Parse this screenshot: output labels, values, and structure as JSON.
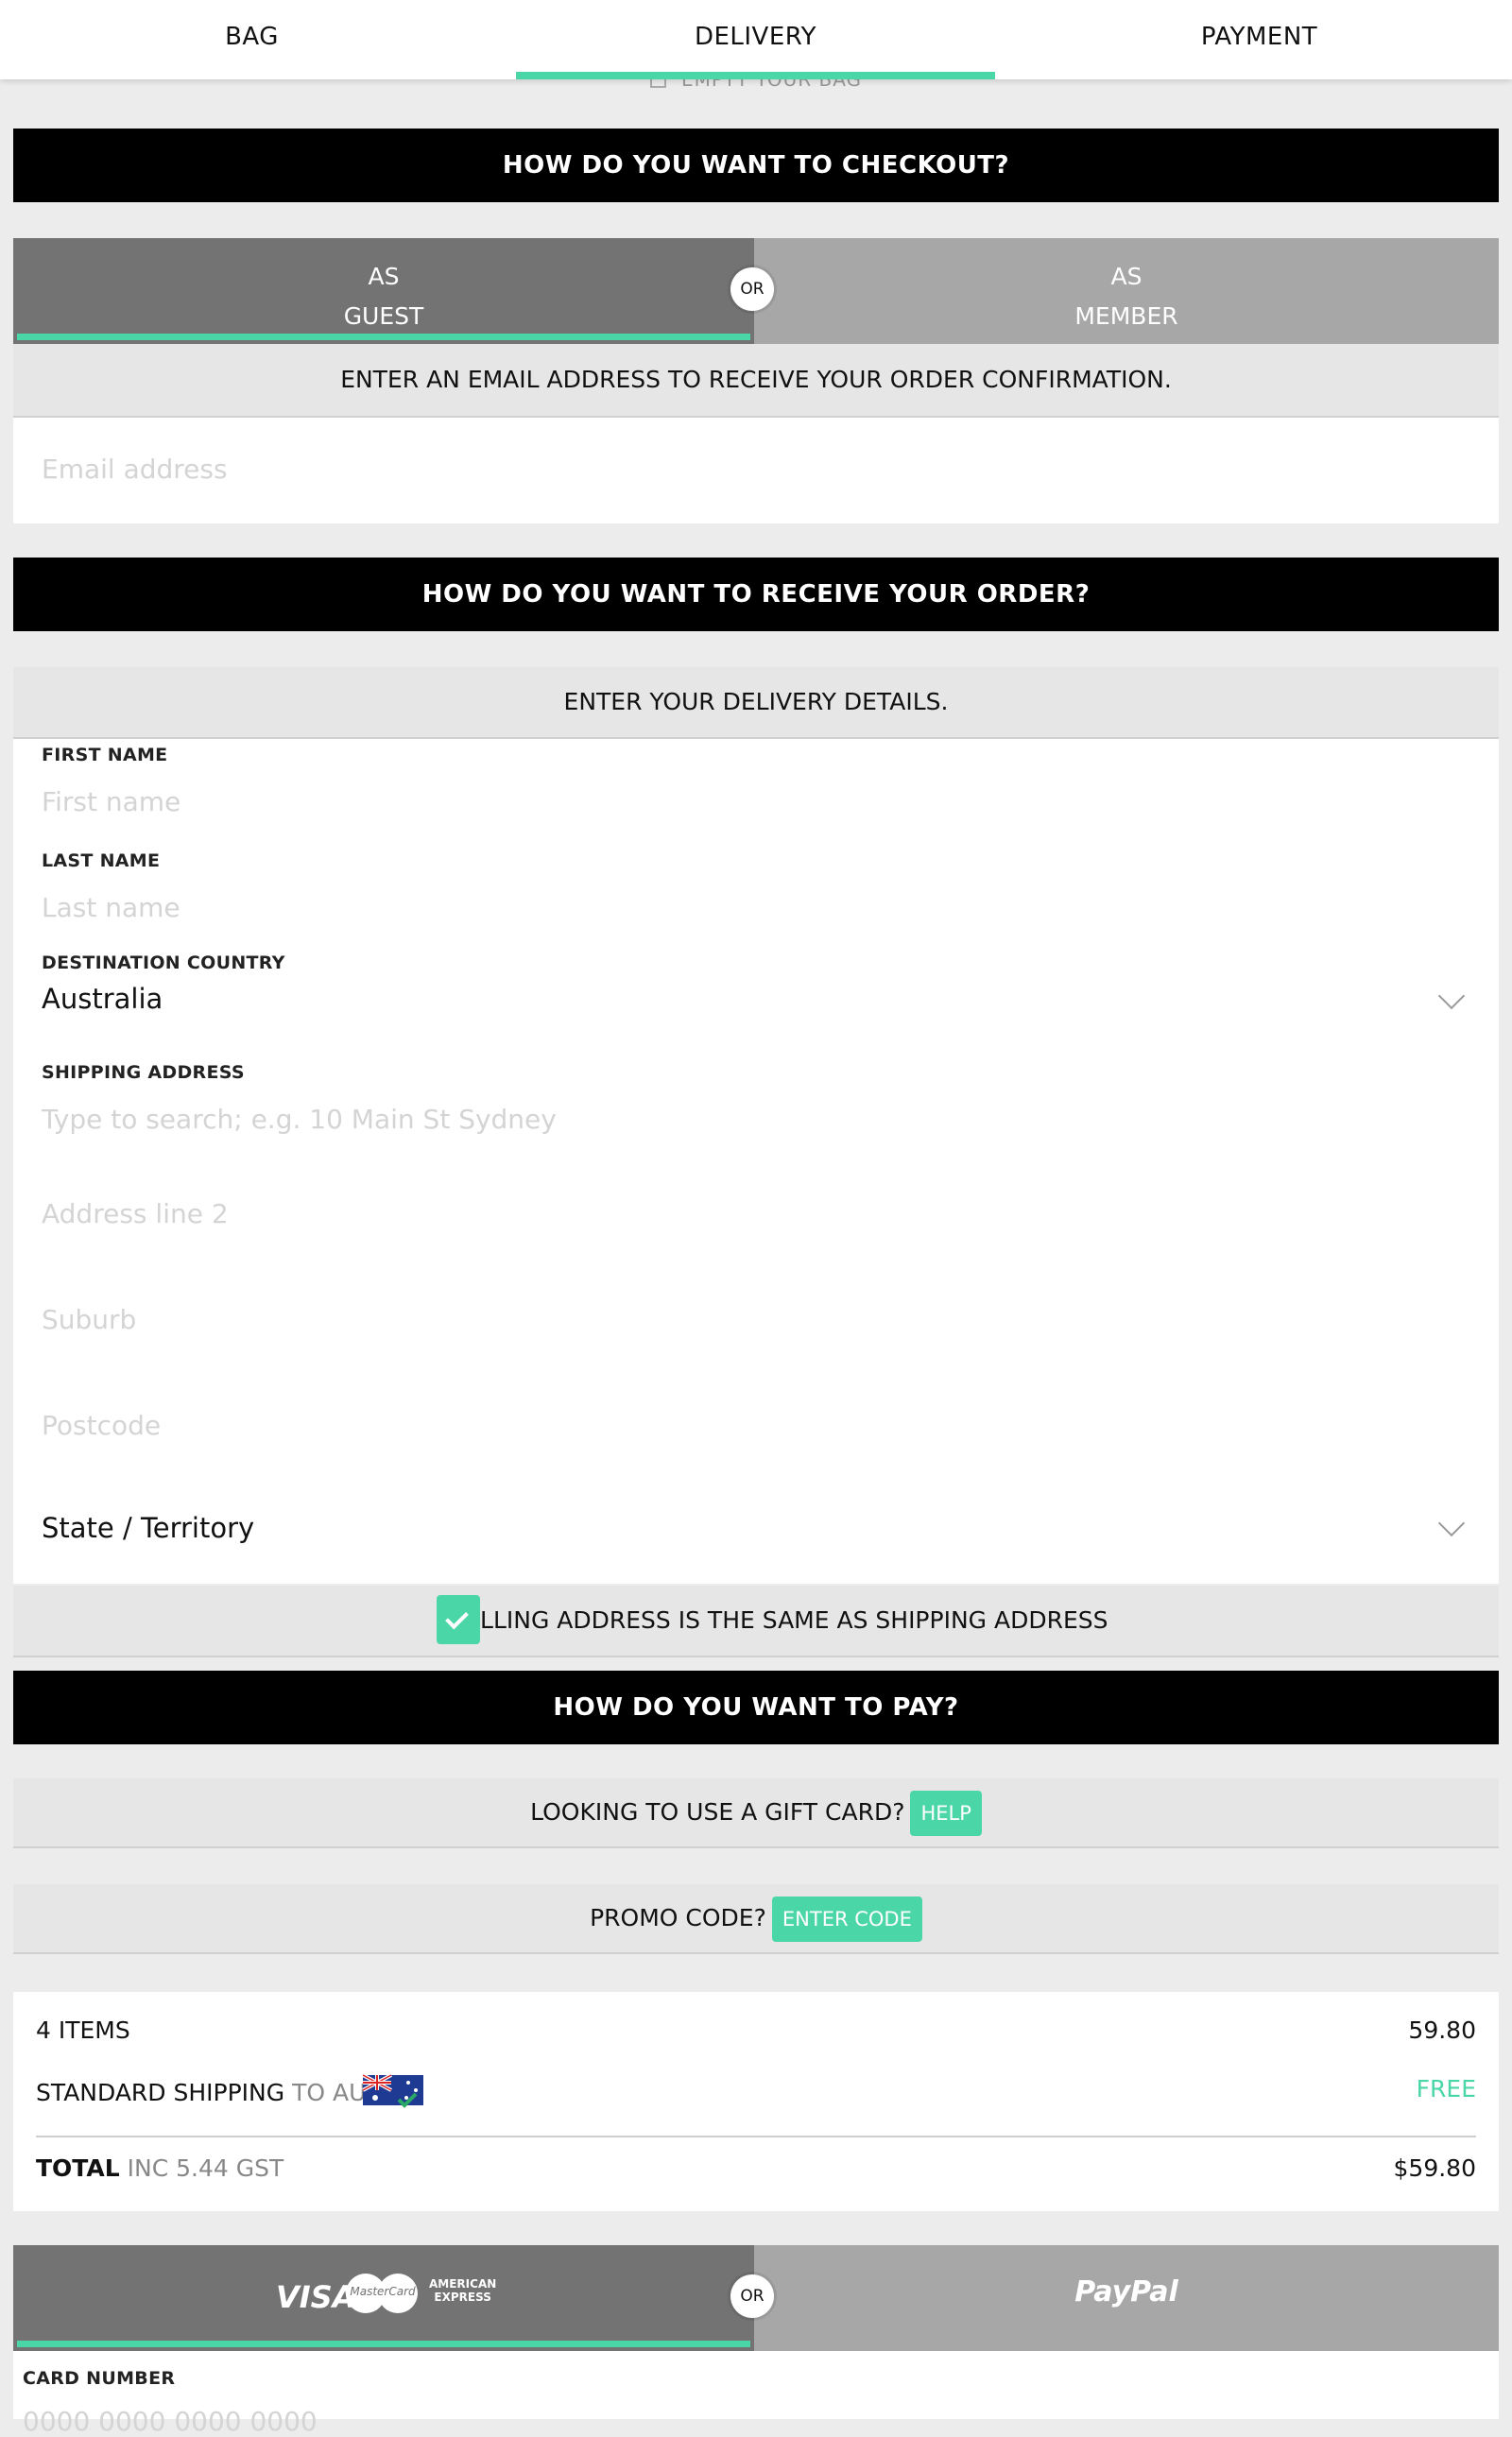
{
  "nav": {
    "tabs": [
      "BAG",
      "DELIVERY",
      "PAYMENT"
    ],
    "active": "DELIVERY"
  },
  "empty_bag_label": "EMPTY YOUR BAG",
  "checkout": {
    "heading": "HOW DO YOU WANT TO CHECKOUT?",
    "guest_line1": "AS",
    "guest_line2": "GUEST",
    "or": "OR",
    "member_line1": "AS",
    "member_line2": "MEMBER",
    "email_prompt": "ENTER AN EMAIL ADDRESS TO RECEIVE YOUR ORDER CONFIRMATION.",
    "email_placeholder": "Email address"
  },
  "delivery": {
    "heading": "HOW DO YOU WANT TO RECEIVE YOUR ORDER?",
    "details_prompt": "ENTER YOUR DELIVERY DETAILS.",
    "first_name_label": "FIRST NAME",
    "first_name_placeholder": "First name",
    "last_name_label": "LAST NAME",
    "last_name_placeholder": "Last name",
    "country_label": "DESTINATION COUNTRY",
    "country_value": "Australia",
    "shipping_label": "SHIPPING ADDRESS",
    "address_placeholder": "Type to search; e.g. 10 Main St Sydney",
    "address2_placeholder": "Address line 2",
    "suburb_placeholder": "Suburb",
    "postcode_placeholder": "Postcode",
    "state_value": "State / Territory",
    "billing_same_label": "BILLING ADDRESS IS THE SAME AS SHIPPING ADDRESS",
    "billing_same_checked": true
  },
  "payment": {
    "heading": "HOW DO YOU WANT TO PAY?",
    "gift_card_label": "LOOKING TO USE A GIFT CARD?",
    "gift_card_help": "HELP",
    "promo_label": "PROMO CODE?",
    "promo_button": "ENTER CODE",
    "visa": "VISA",
    "mastercard": "MasterCard",
    "amex_line1": "AMERICAN",
    "amex_line2": "EXPRESS",
    "or": "OR",
    "paypal": "PayPal",
    "card_number_label": "CARD NUMBER",
    "card_number_placeholder": "0000 0000 0000 0000"
  },
  "summary": {
    "items_label": "4 ITEMS",
    "items_value": "59.80",
    "shipping_label": "STANDARD SHIPPING",
    "shipping_dest": "TO AU",
    "shipping_value": "FREE",
    "total_label": "TOTAL",
    "total_tax": "INC 5.44 GST",
    "total_value": "$59.80"
  },
  "colors": {
    "accent": "#4bd6a8",
    "dark_toggle": "#737373",
    "light_toggle": "#a7a7a7",
    "bar": "#000000"
  }
}
